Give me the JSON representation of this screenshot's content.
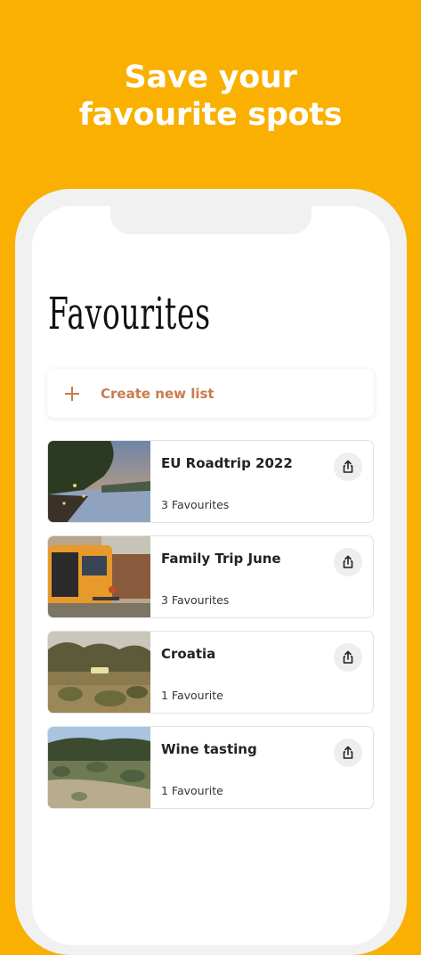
{
  "headline": {
    "line1": "Save your",
    "line2": "favourite spots"
  },
  "page": {
    "title": "Favourites"
  },
  "create_list": {
    "label": "Create new list",
    "icon": "plus-icon"
  },
  "lists": [
    {
      "title": "EU Roadtrip 2022",
      "count": "3 Favourites",
      "image": "lakeside-evening"
    },
    {
      "title": "Family Trip June",
      "count": "3 Favourites",
      "image": "camper-van"
    },
    {
      "title": "Croatia",
      "count": "1 Favourite",
      "image": "orchard-field"
    },
    {
      "title": "Wine tasting",
      "count": "1 Favourite",
      "image": "hillside-vineyard"
    }
  ],
  "colors": {
    "background": "#F9B000",
    "accent": "#C97B4F"
  }
}
